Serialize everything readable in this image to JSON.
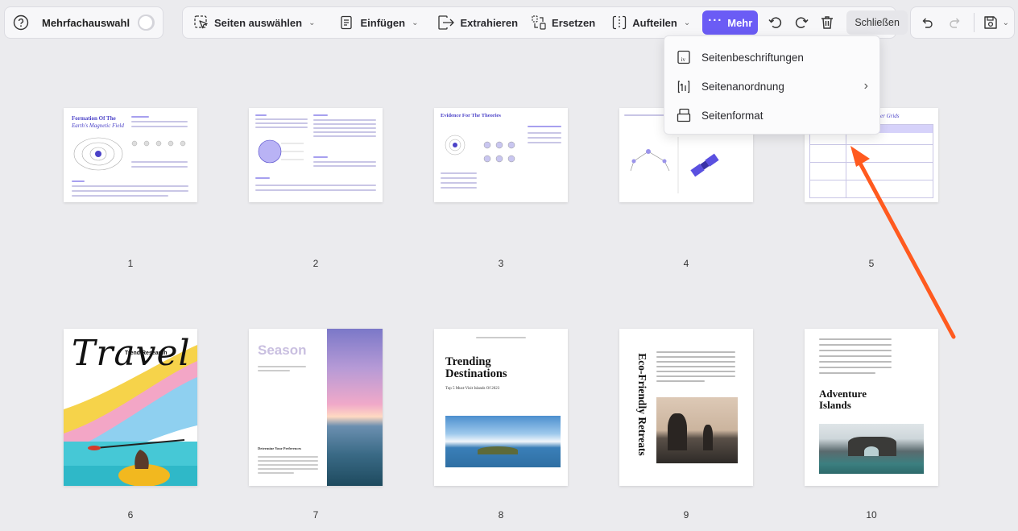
{
  "toolbar_left": {
    "multi_select_label": "Mehrfachauswahl"
  },
  "toolbar_main": {
    "select_pages": "Seiten auswählen",
    "insert": "Einfügen",
    "extract": "Extrahieren",
    "replace": "Ersetzen",
    "split": "Aufteilen",
    "more": "Mehr",
    "close": "Schließen"
  },
  "more_menu": {
    "items": [
      {
        "label": "Seitenbeschriftungen"
      },
      {
        "label": "Seitenanordnung"
      },
      {
        "label": "Seitenformat"
      }
    ]
  },
  "pages": [
    {
      "number": "1",
      "title_a": "Formation Of The",
      "title_b": "Earth's Magnetic Field"
    },
    {
      "number": "2"
    },
    {
      "number": "3",
      "title": "Evidence For The Theories"
    },
    {
      "number": "4"
    },
    {
      "number": "5",
      "title": "er Grids"
    },
    {
      "number": "6",
      "title": "Travel",
      "subtitle": "Trend Research"
    },
    {
      "number": "7",
      "title": "Season",
      "footer": "Determine Your Preferences"
    },
    {
      "number": "8",
      "title": "Trending Destinations",
      "subtitle": "Top 5 Must-Visit Islands Of 2023"
    },
    {
      "number": "9",
      "title": "Eco-Friendly Retreats"
    },
    {
      "number": "10",
      "title": "Adventure Islands"
    }
  ],
  "colors": {
    "accent": "#6b5cf5",
    "arrow": "#ff5a1f",
    "doc_accent": "#4b42c8"
  }
}
